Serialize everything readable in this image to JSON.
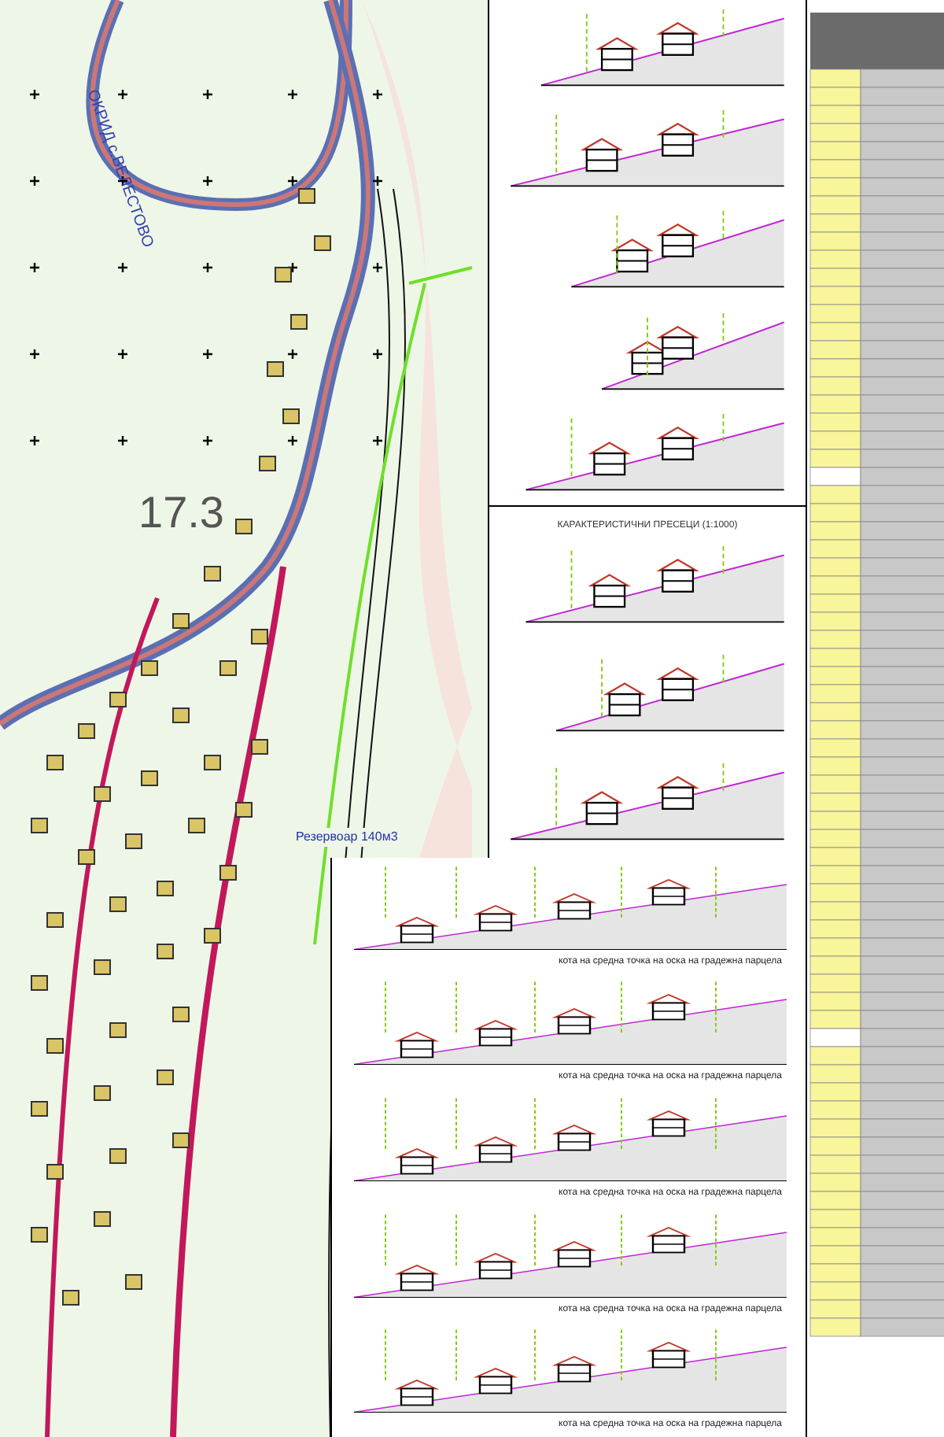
{
  "map": {
    "village_label": "ОКРИД с.ВЕЛЕСТОВО",
    "zone_label": "17.3",
    "reservoir_label": "Резервоар 140м3"
  },
  "sections_panel": {
    "title": "КАРАКТЕРИСТИЧНИ ПРЕСЕЦИ (1:1000)",
    "sections": [
      {
        "annotation": "кота на средна точка на оска на градежна парцела"
      },
      {
        "annotation": "кота на средна точка на оска на градежна парцела"
      },
      {
        "annotation": "кота на средна точка на оска на градежна парцела"
      },
      {
        "annotation": "кота на средна точка на оска на градежна парцела"
      },
      {
        "annotation": "кота на средна точка на оска на градежна парцела"
      }
    ]
  }
}
